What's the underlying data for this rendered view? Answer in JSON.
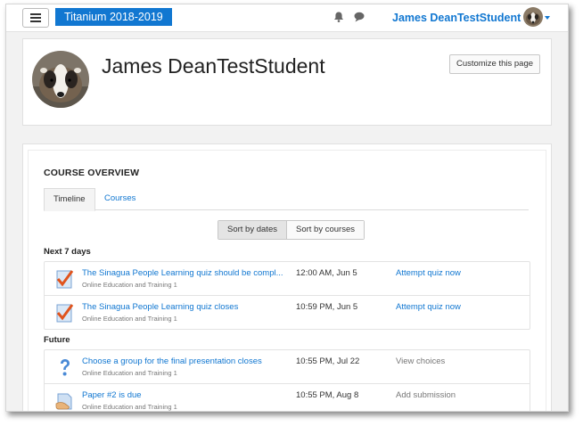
{
  "navbar": {
    "site_title": "Titanium 2018-2019",
    "user_name": "James DeanTestStudent",
    "icons": [
      "menu-icon",
      "bell-icon",
      "chat-icon",
      "chevron-down-icon"
    ]
  },
  "header": {
    "name": "James DeanTestStudent",
    "customize_label": "Customize this page"
  },
  "overview": {
    "title": "COURSE OVERVIEW",
    "tabs": [
      {
        "label": "Timeline",
        "active": true
      },
      {
        "label": "Courses",
        "active": false
      }
    ],
    "sort": {
      "by_dates": "Sort by dates",
      "by_courses": "Sort by courses",
      "active": "by_dates"
    },
    "sections": [
      {
        "label": "Next 7 days",
        "events": [
          {
            "icon": "quiz-icon",
            "title": "The Sinagua People Learning quiz should be compl...",
            "course": "Online Education and Training 1",
            "time": "12:00 AM, Jun 5",
            "action": "Attempt quiz now",
            "action_style": "link"
          },
          {
            "icon": "quiz-icon",
            "title": "The Sinagua People Learning quiz closes",
            "course": "Online Education and Training 1",
            "time": "10:59 PM, Jun 5",
            "action": "Attempt quiz now",
            "action_style": "link"
          }
        ]
      },
      {
        "label": "Future",
        "events": [
          {
            "icon": "choice-icon",
            "title": "Choose a group for the final presentation closes",
            "course": "Online Education and Training 1",
            "time": "10:55 PM, Jul 22",
            "action": "View choices",
            "action_style": "muted"
          },
          {
            "icon": "assignment-icon",
            "title": "Paper #2 is due",
            "course": "Online Education and Training 1",
            "time": "10:55 PM, Aug 8",
            "action": "Add submission",
            "action_style": "muted"
          }
        ]
      }
    ]
  },
  "colors": {
    "accent": "#1177d1",
    "background": "#f2f2f2",
    "muted_text": "#777777"
  }
}
